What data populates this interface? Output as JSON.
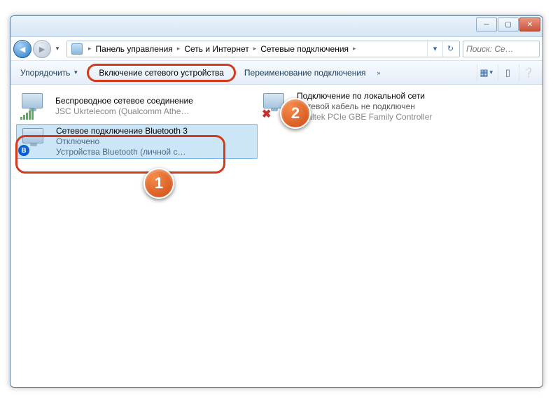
{
  "breadcrumbs": {
    "b1": "Панель управления",
    "b2": "Сеть и Интернет",
    "b3": "Сетевые подключения"
  },
  "search": {
    "placeholder": "Поиск: Се…"
  },
  "toolbar": {
    "organize": "Упорядочить",
    "enable": "Включение сетевого устройства",
    "rename": "Переименование подключения"
  },
  "connections": [
    {
      "title": "Беспроводное сетевое соединение",
      "status": "",
      "detail": "JSC Ukrtelecom (Qualcomm Athe…"
    },
    {
      "title": "Подключение по локальной сети",
      "status": "Сетевой кабель не подключен",
      "detail": "Realtek PCIe GBE Family Controller"
    },
    {
      "title": "Сетевое подключение Bluetooth 3",
      "status": "Отключено",
      "detail": "Устройства Bluetooth (личной с…"
    }
  ],
  "callouts": {
    "c1": "1",
    "c2": "2"
  }
}
